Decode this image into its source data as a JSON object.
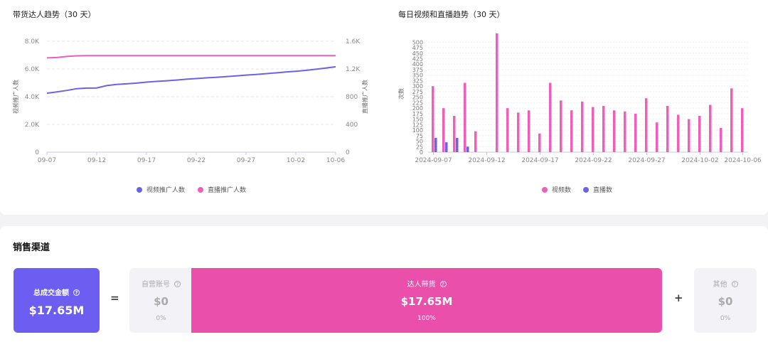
{
  "left_chart": {
    "title": "带货达人趋势（30 天）",
    "legend": [
      {
        "label": "视频推广人数",
        "color": "#6b63e6"
      },
      {
        "label": "直播推广人数",
        "color": "#ee5fb9"
      }
    ],
    "chart_data": {
      "type": "line",
      "title": "带货达人趋势（30 天）",
      "x_ticks": [
        "09-07",
        "09-12",
        "09-17",
        "09-22",
        "09-27",
        "10-02",
        "10-06"
      ],
      "x": [
        "09-07",
        "09-08",
        "09-09",
        "09-10",
        "09-11",
        "09-12",
        "09-13",
        "09-14",
        "09-15",
        "09-16",
        "09-17",
        "09-18",
        "09-19",
        "09-20",
        "09-21",
        "09-22",
        "09-23",
        "09-24",
        "09-25",
        "09-26",
        "09-27",
        "09-28",
        "09-29",
        "09-30",
        "10-01",
        "10-02",
        "10-03",
        "10-04",
        "10-05",
        "10-06"
      ],
      "ylabel_left": "视频推广人数",
      "ylabel_right": "直播推广人数",
      "ylim_left": [
        0,
        8000
      ],
      "ylim_right": [
        0,
        1600
      ],
      "y_ticks_left": [
        "0",
        "2.0K",
        "4.0K",
        "6.0K",
        "8.0K"
      ],
      "y_ticks_right": [
        "0",
        "400",
        "800",
        "1.2K",
        "1.6K"
      ],
      "series": [
        {
          "name": "视频推广人数",
          "axis": "left",
          "color": "#6b63e6",
          "values": [
            4250,
            4350,
            4450,
            4580,
            4620,
            4630,
            4800,
            4880,
            4930,
            4980,
            5050,
            5100,
            5150,
            5200,
            5260,
            5310,
            5360,
            5400,
            5450,
            5500,
            5560,
            5600,
            5660,
            5720,
            5780,
            5830,
            5900,
            5980,
            6060,
            6160
          ]
        },
        {
          "name": "直播推广人数",
          "axis": "right",
          "color": "#ee5fb9",
          "values": [
            1360,
            1365,
            1380,
            1390,
            1392,
            1392,
            1392,
            1392,
            1392,
            1392,
            1392,
            1392,
            1392,
            1392,
            1392,
            1392,
            1392,
            1392,
            1392,
            1392,
            1392,
            1392,
            1392,
            1392,
            1392,
            1392,
            1392,
            1392,
            1392,
            1392
          ]
        }
      ],
      "grid": true,
      "legend_position": "bottom"
    }
  },
  "right_chart": {
    "title": "每日视频和直播趋势（30 天）",
    "legend": [
      {
        "label": "视频数",
        "color": "#ee5fb9"
      },
      {
        "label": "直播数",
        "color": "#6b63e6"
      }
    ],
    "chart_data": {
      "type": "bar",
      "title": "每日视频和直播趋势（30 天）",
      "ylabel": "次数",
      "ylim": [
        0,
        530
      ],
      "y_ticks": [
        "0",
        "25",
        "50",
        "75",
        "100",
        "125",
        "150",
        "175",
        "200",
        "225",
        "250",
        "275",
        "300",
        "325",
        "350",
        "375",
        "400",
        "425",
        "450",
        "475",
        "500"
      ],
      "x_ticks": [
        "2024-09-07",
        "2024-09-12",
        "2024-09-17",
        "2024-09-22",
        "2024-09-27",
        "2024-10-02",
        "2024-10-06"
      ],
      "categories": [
        "2024-09-07",
        "2024-09-08",
        "2024-09-09",
        "2024-09-10",
        "2024-09-11",
        "2024-09-12",
        "2024-09-13",
        "2024-09-14",
        "2024-09-15",
        "2024-09-16",
        "2024-09-17",
        "2024-09-18",
        "2024-09-19",
        "2024-09-20",
        "2024-09-21",
        "2024-09-22",
        "2024-09-23",
        "2024-09-24",
        "2024-09-25",
        "2024-09-26",
        "2024-09-27",
        "2024-09-28",
        "2024-09-29",
        "2024-09-30",
        "2024-10-01",
        "2024-10-02",
        "2024-10-03",
        "2024-10-04",
        "2024-10-05",
        "2024-10-06"
      ],
      "series": [
        {
          "name": "视频数",
          "color": "#ee5fb9",
          "values": [
            300,
            200,
            165,
            315,
            95,
            0,
            540,
            200,
            180,
            190,
            85,
            315,
            235,
            190,
            230,
            205,
            210,
            190,
            185,
            175,
            245,
            135,
            210,
            170,
            150,
            165,
            215,
            110,
            290,
            200
          ]
        },
        {
          "name": "直播数",
          "color": "#6b63e6",
          "values": [
            65,
            45,
            65,
            25,
            0,
            0,
            0,
            0,
            0,
            0,
            0,
            0,
            0,
            0,
            0,
            0,
            0,
            0,
            0,
            0,
            0,
            0,
            0,
            0,
            0,
            0,
            0,
            0,
            0,
            0
          ]
        }
      ],
      "grid": true,
      "legend_position": "bottom"
    }
  },
  "sales": {
    "title": "销售渠道",
    "total": {
      "label": "总成交金额",
      "value": "$17.65M"
    },
    "equals": "=",
    "plus": "+",
    "self": {
      "label": "自营账号",
      "value": "$0",
      "pct": "0%"
    },
    "creator": {
      "label": "达人带货",
      "value": "$17.65M",
      "pct": "100%"
    },
    "other": {
      "label": "其他",
      "value": "$0",
      "pct": "0%"
    },
    "help_icon": "?"
  },
  "colors": {
    "purple": "#6b63e6",
    "pink": "#ee5fb9"
  }
}
